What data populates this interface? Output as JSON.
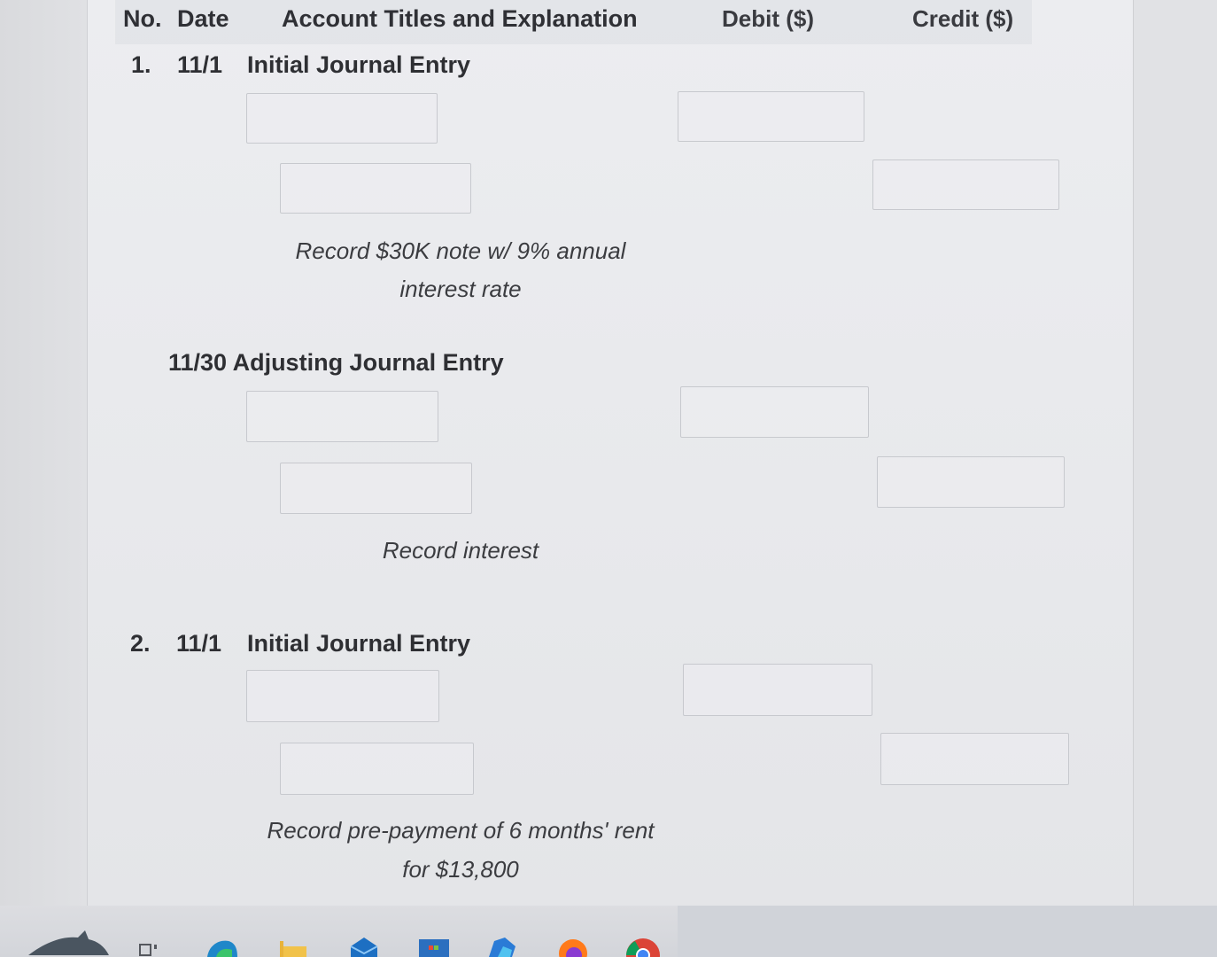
{
  "header": {
    "no": "No.",
    "date": "Date",
    "account": "Account Titles and Explanation",
    "debit": "Debit ($)",
    "credit": "Credit ($)"
  },
  "entries": [
    {
      "number": "1.",
      "date": "11/1",
      "title": "Initial Journal Entry",
      "note_line1": "Record $30K note w/ 9% annual",
      "note_line2": "interest rate"
    },
    {
      "date_title": "11/30 Adjusting Journal Entry",
      "note_line1": "Record interest"
    },
    {
      "number": "2.",
      "date": "11/1",
      "title": "Initial Journal Entry",
      "note_line1": "Record pre-payment of 6 months' rent",
      "note_line2": "for $13,800"
    }
  ],
  "taskbar": {
    "icons": [
      "shark-wallpaper",
      "task-view-icon",
      "edge-icon",
      "file-explorer-icon",
      "mail-icon",
      "store-icon",
      "app-icon",
      "firefox-icon",
      "chrome-icon"
    ]
  }
}
